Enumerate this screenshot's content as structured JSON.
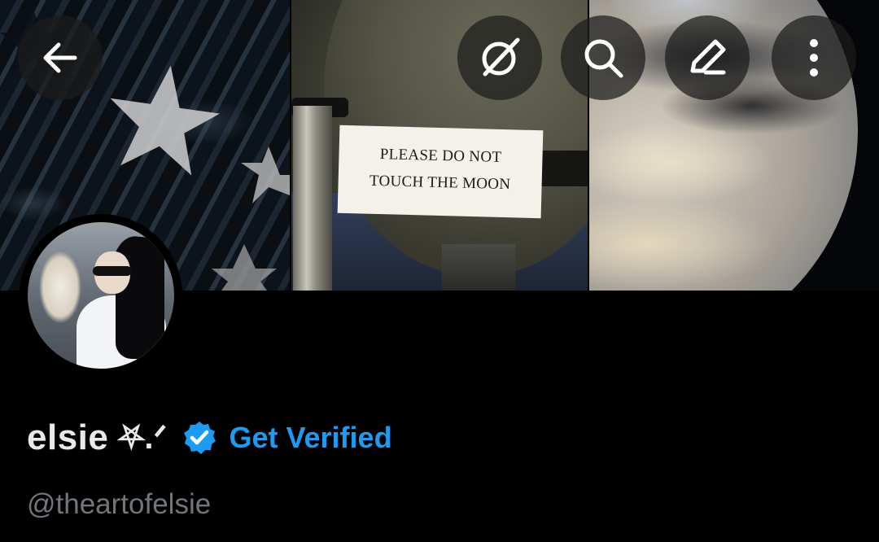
{
  "banner": {
    "sign_line1": "PLEASE DO NOT",
    "sign_line2": "TOUCH THE MOON"
  },
  "toolbar": {
    "back_icon": "arrow-left-icon",
    "grok_icon": "grok-icon",
    "search_icon": "search-icon",
    "edit_icon": "edit-icon",
    "more_icon": "more-vertical-icon"
  },
  "profile": {
    "display_name": "elsie",
    "name_symbols": "⛧.ᐟ",
    "verified_badge_color": "#1d9bf0",
    "get_verified_label": "Get Verified",
    "handle": "@theartofelsie"
  },
  "colors": {
    "background": "#000000",
    "accent": "#1d9bf0",
    "text_primary": "#e7e9ea",
    "text_secondary": "#71767b"
  }
}
